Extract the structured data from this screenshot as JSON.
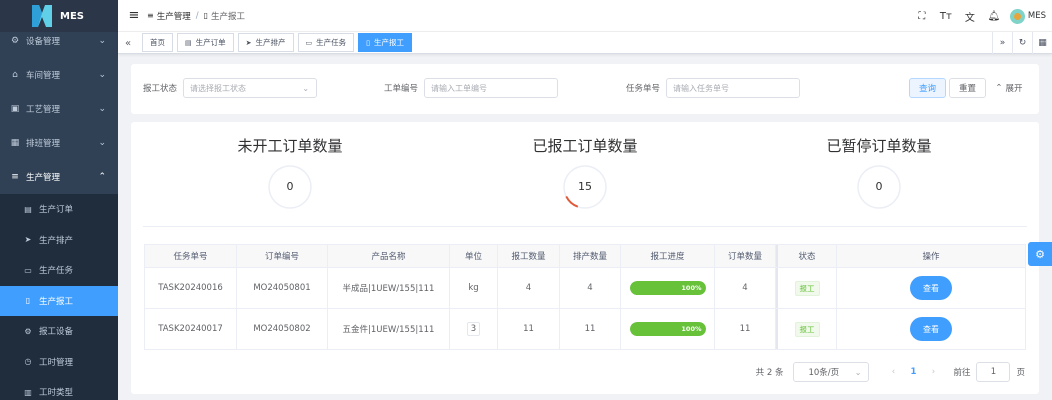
{
  "app": {
    "name": "MES"
  },
  "sidebar": {
    "items": [
      {
        "label": "设备管理",
        "icon": "device-icon"
      },
      {
        "label": "车间管理",
        "icon": "workshop-icon"
      },
      {
        "label": "工艺管理",
        "icon": "process-icon"
      },
      {
        "label": "排班管理",
        "icon": "calendar-icon"
      },
      {
        "label": "生产管理",
        "icon": "database-icon"
      }
    ],
    "subitems": [
      {
        "label": "生产订单",
        "icon": "order-icon"
      },
      {
        "label": "生产排产",
        "icon": "send-icon"
      },
      {
        "label": "生产任务",
        "icon": "task-icon"
      },
      {
        "label": "生产报工",
        "icon": "report-icon"
      },
      {
        "label": "报工设备",
        "icon": "gear-icon"
      },
      {
        "label": "工时管理",
        "icon": "clock-icon"
      },
      {
        "label": "工时类型",
        "icon": "doc-icon"
      }
    ]
  },
  "navbar": {
    "breadcrumb": [
      "生产管理",
      "生产报工"
    ],
    "breadcrumb_separator": "/",
    "user": "MES"
  },
  "tags": [
    "首页",
    "生产订单",
    "生产排产",
    "生产任务",
    "生产报工"
  ],
  "search": {
    "report_status": {
      "label": "报工状态",
      "placeholder": "请选择报工状态"
    },
    "order_no": {
      "label": "工单编号",
      "placeholder": "请输入工单编号"
    },
    "task_no": {
      "label": "任务单号",
      "placeholder": "请输入任务单号"
    },
    "query_label": "查询",
    "reset_label": "重置",
    "expand_label": "展开"
  },
  "stats": [
    {
      "title": "未开工订单数量",
      "value": "0",
      "progress": 0
    },
    {
      "title": "已报工订单数量",
      "value": "15",
      "progress": 0.12
    },
    {
      "title": "已暂停订单数量",
      "value": "0",
      "progress": 0
    }
  ],
  "table": {
    "headers": [
      "任务单号",
      "订单编号",
      "产品名称",
      "单位",
      "报工数量",
      "排产数量",
      "报工进度",
      "订单数量",
      "状态",
      "操作"
    ],
    "rows": [
      {
        "task_no": "TASK20240016",
        "order_no": "MO24050801",
        "product": "半成品|1UEW/155|111",
        "unit": "kg",
        "report_qty": "4",
        "plan_qty": "4",
        "progress": "100%",
        "progress_value": 1.0,
        "order_qty": "4",
        "status": "报工",
        "action": "查看"
      },
      {
        "task_no": "TASK20240017",
        "order_no": "MO24050802",
        "product": "五金件|1UEW/155|111",
        "unit": "3",
        "report_qty": "11",
        "plan_qty": "11",
        "progress": "100%",
        "progress_value": 1.0,
        "order_qty": "11",
        "status": "报工",
        "action": "查看"
      }
    ]
  },
  "pagination": {
    "total": "共 2 条",
    "page_size": "10条/页",
    "current_page": "1",
    "goto_label": "前往",
    "goto_value": "1",
    "page_suffix": "页"
  },
  "colors": {
    "primary": "#409eff",
    "sidebar_bg": "#304156",
    "success": "#67c23a",
    "ring_accent": "#e05a3a"
  }
}
